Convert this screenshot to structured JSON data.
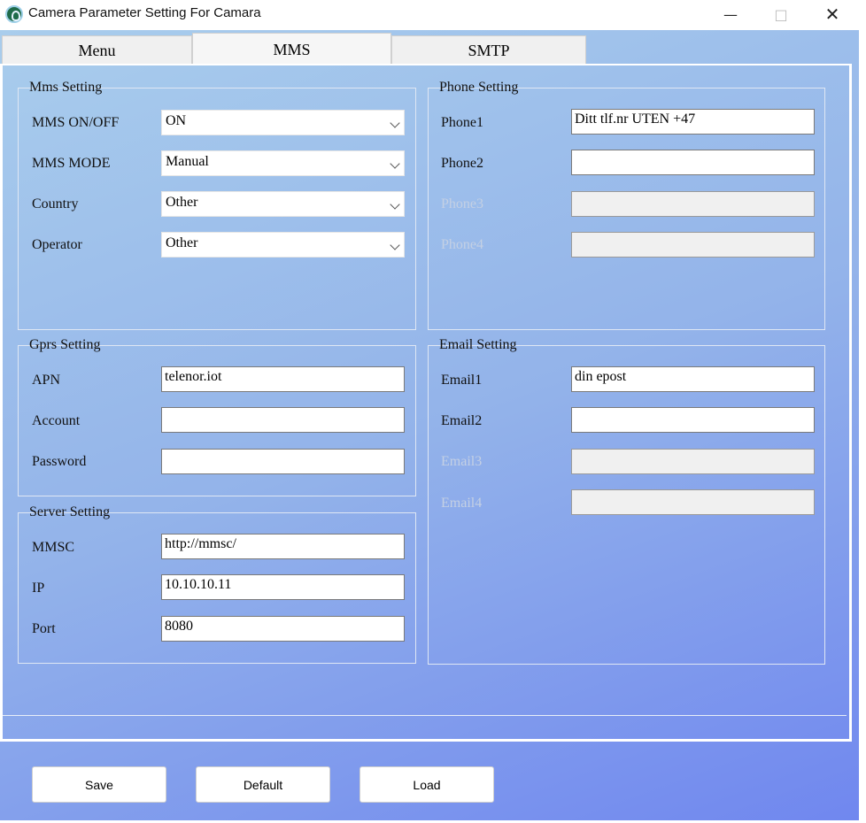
{
  "window": {
    "title": "Camera Parameter Setting For  Camara"
  },
  "tabs": [
    "Menu",
    "MMS",
    "SMTP"
  ],
  "mms_setting": {
    "title": "Mms Setting",
    "rows": [
      {
        "label": "MMS ON/OFF",
        "value": "ON"
      },
      {
        "label": "MMS MODE",
        "value": "Manual"
      },
      {
        "label": "Country",
        "value": "Other"
      },
      {
        "label": "Operator",
        "value": "Other"
      }
    ]
  },
  "gprs_setting": {
    "title": "Gprs Setting",
    "rows": [
      {
        "label": "APN",
        "value": "telenor.iot"
      },
      {
        "label": "Account",
        "value": ""
      },
      {
        "label": "Password",
        "value": ""
      }
    ]
  },
  "server_setting": {
    "title": "Server Setting",
    "rows": [
      {
        "label": "MMSC",
        "value": "http://mmsc/"
      },
      {
        "label": "IP",
        "value": "10.10.10.11"
      },
      {
        "label": "Port",
        "value": "8080"
      }
    ]
  },
  "phone_setting": {
    "title": "Phone Setting",
    "rows": [
      {
        "label": "Phone1",
        "value": "Ditt tlf.nr UTEN +47",
        "enabled": true
      },
      {
        "label": "Phone2",
        "value": "",
        "enabled": true
      },
      {
        "label": "Phone3",
        "value": "",
        "enabled": false
      },
      {
        "label": "Phone4",
        "value": "",
        "enabled": false
      }
    ]
  },
  "email_setting": {
    "title": "Email Setting",
    "rows": [
      {
        "label": "Email1",
        "value": "din epost",
        "enabled": true
      },
      {
        "label": "Email2",
        "value": "",
        "enabled": true
      },
      {
        "label": "Email3",
        "value": "",
        "enabled": false
      },
      {
        "label": "Email4",
        "value": "",
        "enabled": false
      }
    ]
  },
  "buttons": {
    "save": "Save",
    "default": "Default",
    "load": "Load"
  }
}
